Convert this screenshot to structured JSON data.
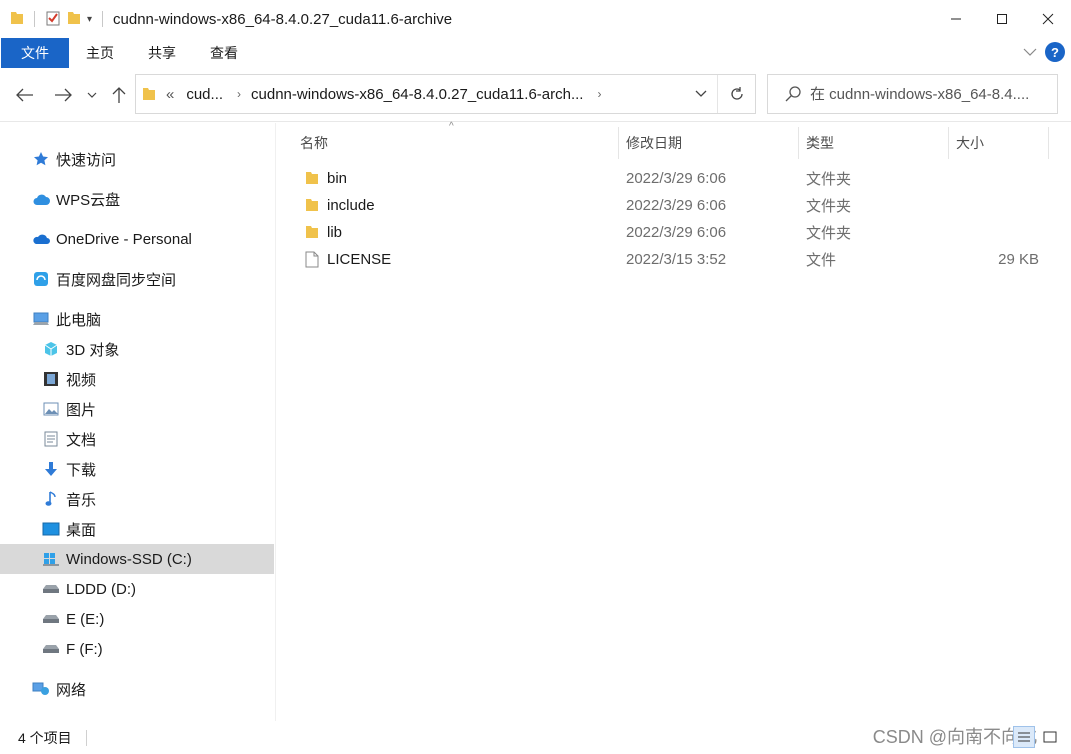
{
  "window": {
    "title": "cudnn-windows-x86_64-8.4.0.27_cuda11.6-archive"
  },
  "ribbon": {
    "tabs": [
      "文件",
      "主页",
      "共享",
      "查看"
    ],
    "help": "?"
  },
  "address": {
    "overflow": "«",
    "crumbs": [
      "cud...",
      "cudnn-windows-x86_64-8.4.0.27_cuda11.6-arch..."
    ]
  },
  "search": {
    "placeholder": "在 cudnn-windows-x86_64-8.4...."
  },
  "sidebar": {
    "items": [
      {
        "label": "快速访问",
        "icon": "star-icon"
      },
      {
        "label": "WPS云盘",
        "icon": "cloud-icon"
      },
      {
        "label": "OneDrive - Personal",
        "icon": "onedrive-icon"
      },
      {
        "label": "百度网盘同步空间",
        "icon": "baidu-netdisk-icon"
      },
      {
        "label": "此电脑",
        "icon": "computer-icon"
      },
      {
        "label": "3D 对象",
        "icon": "cube-icon"
      },
      {
        "label": "视频",
        "icon": "video-icon"
      },
      {
        "label": "图片",
        "icon": "pictures-icon"
      },
      {
        "label": "文档",
        "icon": "document-icon"
      },
      {
        "label": "下载",
        "icon": "download-icon"
      },
      {
        "label": "音乐",
        "icon": "music-icon"
      },
      {
        "label": "桌面",
        "icon": "desktop-icon"
      },
      {
        "label": "Windows-SSD (C:)",
        "icon": "windows-drive-icon"
      },
      {
        "label": "LDDD (D:)",
        "icon": "drive-icon"
      },
      {
        "label": "E (E:)",
        "icon": "drive-icon"
      },
      {
        "label": "F (F:)",
        "icon": "drive-icon"
      },
      {
        "label": "网络",
        "icon": "network-icon"
      }
    ]
  },
  "columns": {
    "name": "名称",
    "modified": "修改日期",
    "type": "类型",
    "size": "大小"
  },
  "files": [
    {
      "name": "bin",
      "modified": "2022/3/29 6:06",
      "type": "文件夹",
      "size": "",
      "icon": "folder-icon"
    },
    {
      "name": "include",
      "modified": "2022/3/29 6:06",
      "type": "文件夹",
      "size": "",
      "icon": "folder-icon"
    },
    {
      "name": "lib",
      "modified": "2022/3/29 6:06",
      "type": "文件夹",
      "size": "",
      "icon": "folder-icon"
    },
    {
      "name": "LICENSE",
      "modified": "2022/3/15 3:52",
      "type": "文件",
      "size": "29 KB",
      "icon": "file-icon"
    }
  ],
  "status": {
    "count": "4 个项目"
  },
  "watermark": "CSDN @向南不向北",
  "colors": {
    "accent": "#1a65c7",
    "folder": "#f0c24b",
    "selected": "#d9d9d9"
  }
}
